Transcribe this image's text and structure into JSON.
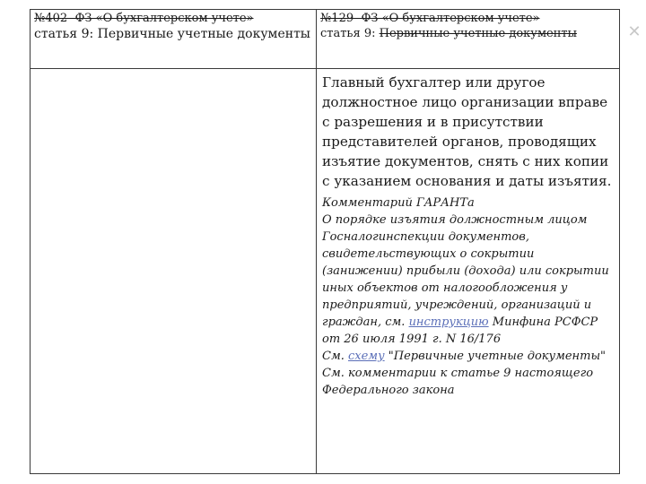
{
  "deco_symbol": "✕",
  "col_left": {
    "title": "№402- ФЗ «О бухгалтерском учете»",
    "article_prefix": "статья 9: ",
    "article_name": "Первичные учетные документы"
  },
  "col_right": {
    "title": "№129- ФЗ «О бухгалтерском учете»",
    "article_prefix": "статья 9: ",
    "article_name": "Первичные учетные документы"
  },
  "body_right": {
    "main_text": "Главный бухгалтер или другое должностное лицо организации вправе с разрешения и в присутствии представителей органов, проводящих изъятие документов, снять с них копии с указанием основания и даты изъятия.",
    "comment_title": "Комментарий ГАРАНТа",
    "comment_p1_before": "О порядке изъятия должностным лицом Госналогинспекции документов, свидетельствующих о сокрытии (занижении) прибыли (дохода) или сокрытии иных объектов от налогообложения у предприятий, учреждений, организаций и граждан, см. ",
    "comment_p1_link": "инструкцию",
    "comment_p1_after": " Минфина РСФСР от 26 июля 1991 г. N 16/176",
    "comment_p2_before": "См. ",
    "comment_p2_link": "схему",
    "comment_p2_after": " \"Первичные учетные документы\"",
    "comment_p3": "См. комментарии к статье 9 настоящего Федерального закона"
  }
}
